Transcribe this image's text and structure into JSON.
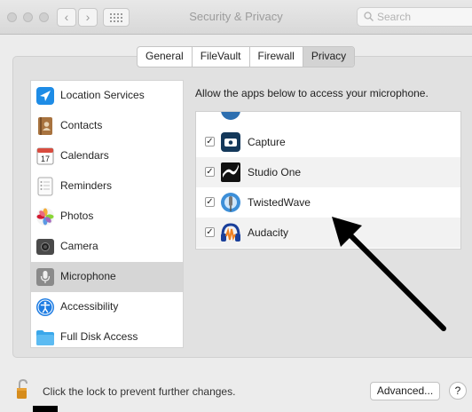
{
  "window": {
    "title": "Security & Privacy",
    "search_placeholder": "Search"
  },
  "tabs": [
    {
      "label": "General",
      "selected": false
    },
    {
      "label": "FileVault",
      "selected": false
    },
    {
      "label": "Firewall",
      "selected": false
    },
    {
      "label": "Privacy",
      "selected": true
    }
  ],
  "sidebar": {
    "items": [
      {
        "label": "Location Services",
        "icon": "location-arrow-icon"
      },
      {
        "label": "Contacts",
        "icon": "contacts-book-icon"
      },
      {
        "label": "Calendars",
        "icon": "calendar-icon",
        "icon_text": "17"
      },
      {
        "label": "Reminders",
        "icon": "reminders-list-icon"
      },
      {
        "label": "Photos",
        "icon": "photos-flower-icon"
      },
      {
        "label": "Camera",
        "icon": "camera-icon"
      },
      {
        "label": "Microphone",
        "icon": "microphone-icon",
        "selected": true
      },
      {
        "label": "Accessibility",
        "icon": "accessibility-icon"
      },
      {
        "label": "Full Disk Access",
        "icon": "folder-icon"
      }
    ]
  },
  "microphone": {
    "description": "Allow the apps below to access your microphone.",
    "apps": [
      {
        "name": "Capture",
        "checked": true,
        "icon": "capture-app-icon"
      },
      {
        "name": "Studio One",
        "checked": true,
        "icon": "studio-one-app-icon"
      },
      {
        "name": "TwistedWave",
        "checked": true,
        "icon": "twistedwave-app-icon"
      },
      {
        "name": "Audacity",
        "checked": true,
        "icon": "audacity-app-icon"
      }
    ]
  },
  "footer": {
    "lock_text": "Click the lock to prevent further changes.",
    "advanced_label": "Advanced...",
    "help_label": "?"
  },
  "colors": {
    "window_bg": "#ececec",
    "selected_row": "#d6d6d6",
    "location_blue": "#1e8ce6",
    "annotation_arrow": "#000000"
  }
}
